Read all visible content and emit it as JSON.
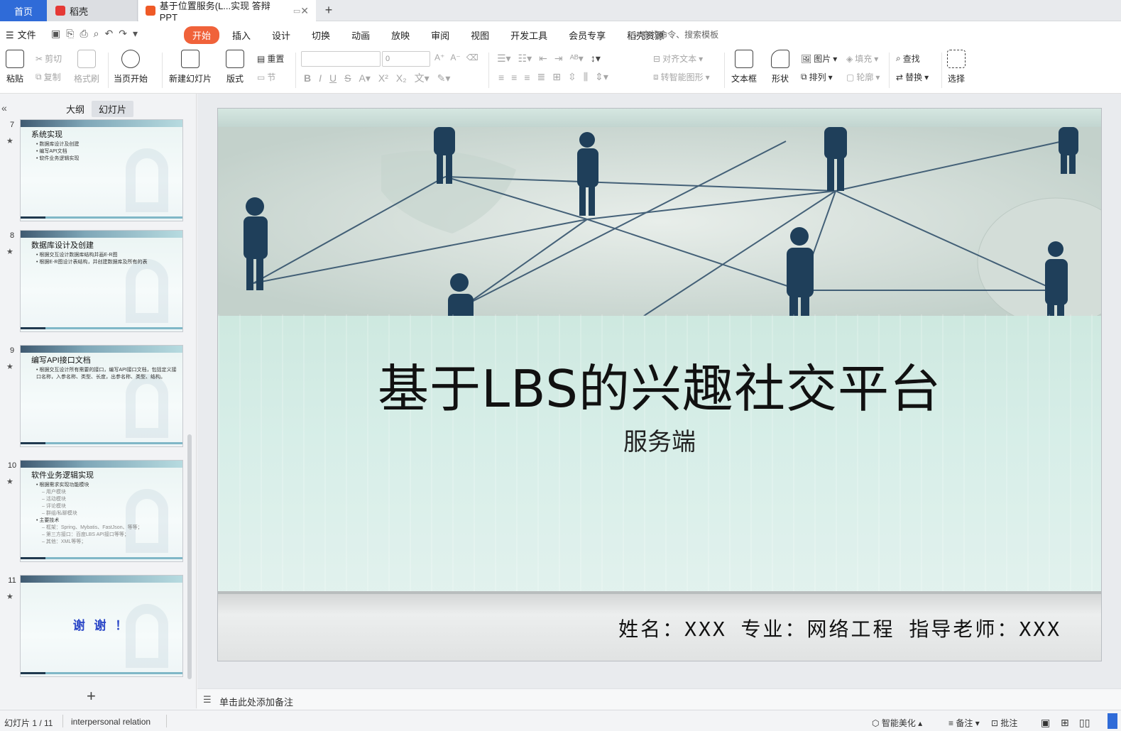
{
  "tabs": {
    "home": "首页",
    "daoke": "稻壳",
    "doc": "基于位置服务(L...实现 答辩PPT"
  },
  "menu": {
    "file": "文件",
    "tabs": [
      "开始",
      "插入",
      "设计",
      "切换",
      "动画",
      "放映",
      "审阅",
      "视图",
      "开发工具",
      "会员专享",
      "稻壳资源"
    ],
    "active_tab": "开始",
    "search": "查找命令、搜索模板"
  },
  "ribbon": {
    "paste": "粘贴",
    "cut": "剪切",
    "copy": "复制",
    "format_painter": "格式刷",
    "from_current": "当页开始",
    "new_slide": "新建幻灯片",
    "layout": "版式",
    "reset": "重置",
    "section": "节",
    "font_size": "0",
    "align_text": "对齐文本",
    "convert_smartart": "转智能图形",
    "textbox": "文本框",
    "shape": "形状",
    "picture": "图片",
    "arrange": "排列",
    "fill": "填充",
    "outline": "轮廓",
    "find": "查找",
    "replace": "替换",
    "select": "选择"
  },
  "left_panel": {
    "tab_outline": "大纲",
    "tab_slides": "幻灯片",
    "active_tab": "幻灯片",
    "thumbnails": [
      {
        "num": "7",
        "title": "系统实现",
        "bullets": [
          "数据库设计及创建",
          "编写API文档",
          "软件业务逻辑实现"
        ],
        "subs": []
      },
      {
        "num": "8",
        "title": "数据库设计及创建",
        "bullets": [
          "根据交互设计数据库结构并画E-R图",
          "根据E-R图设计表结构，并创建数据库及所有的表"
        ],
        "subs": []
      },
      {
        "num": "9",
        "title": "编写API接口文档",
        "bullets": [
          "根据交互设计所有需要的接口，编写API接口文档，包括定义接口名称，入参名称、类型、长度，出参名称、类型、结构。"
        ],
        "subs": []
      },
      {
        "num": "10",
        "title": "软件业务逻辑实现",
        "bullets": [
          "根据需求实现功能模块"
        ],
        "subs": [
          "用户模块",
          "活动模块",
          "评论模块",
          "群组/私聊模块"
        ],
        "bullets2": [
          "主要技术"
        ],
        "subs2": [
          "框架：Spring、Mybatis、FastJson、等等；",
          "第三方接口：百度LBS API接口等等；",
          "其他：XML等等；"
        ]
      },
      {
        "num": "11",
        "title": "",
        "thanks": "谢 谢 ！"
      }
    ]
  },
  "slide": {
    "title": "基于LBS的兴趣社交平台",
    "subtitle": "服务端",
    "footer": "姓名：XXX 专业：网络工程 指导老师：XXX"
  },
  "notes": {
    "placeholder": "单击此处添加备注"
  },
  "status": {
    "slide_counter": "幻灯片 1 / 11",
    "theme": "interpersonal relation",
    "smart_beautify": "智能美化",
    "notes": "备注",
    "comments": "批注"
  }
}
